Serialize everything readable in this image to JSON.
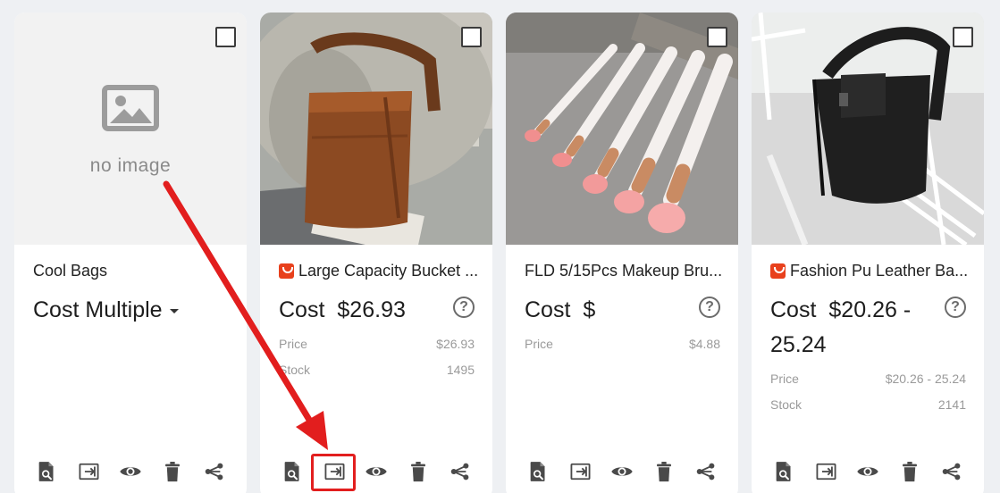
{
  "cards": [
    {
      "placeholder_text": "no image",
      "title": "Cool Bags",
      "cost_label": "Cost",
      "cost_value": "Multiple",
      "details": []
    },
    {
      "title": "Large Capacity Bucket ...",
      "cost_label": "Cost",
      "cost_value": "$26.93",
      "details": [
        {
          "label": "Price",
          "value": "$26.93"
        },
        {
          "label": "Stock",
          "value": "1495"
        }
      ]
    },
    {
      "title": "FLD 5/15Pcs Makeup Bru...",
      "cost_label": "Cost",
      "cost_value": "$",
      "details": [
        {
          "label": "Price",
          "value": "$4.88"
        }
      ]
    },
    {
      "title": "Fashion Pu Leather Ba...",
      "cost_label": "Cost",
      "cost_value": "$20.26 - 25.24",
      "details": [
        {
          "label": "Price",
          "value": "$20.26 - 25.24"
        },
        {
          "label": "Stock",
          "value": "2141"
        }
      ]
    }
  ],
  "help_symbol": "?",
  "colors": {
    "ali_badge": "#e8401c",
    "annotation": "#e21e1e",
    "icon": "#4a4a4a",
    "background": "#eef0f3"
  },
  "action_icons": [
    "search-document-icon",
    "push-icon",
    "eye-icon",
    "trash-icon",
    "share-icon"
  ]
}
